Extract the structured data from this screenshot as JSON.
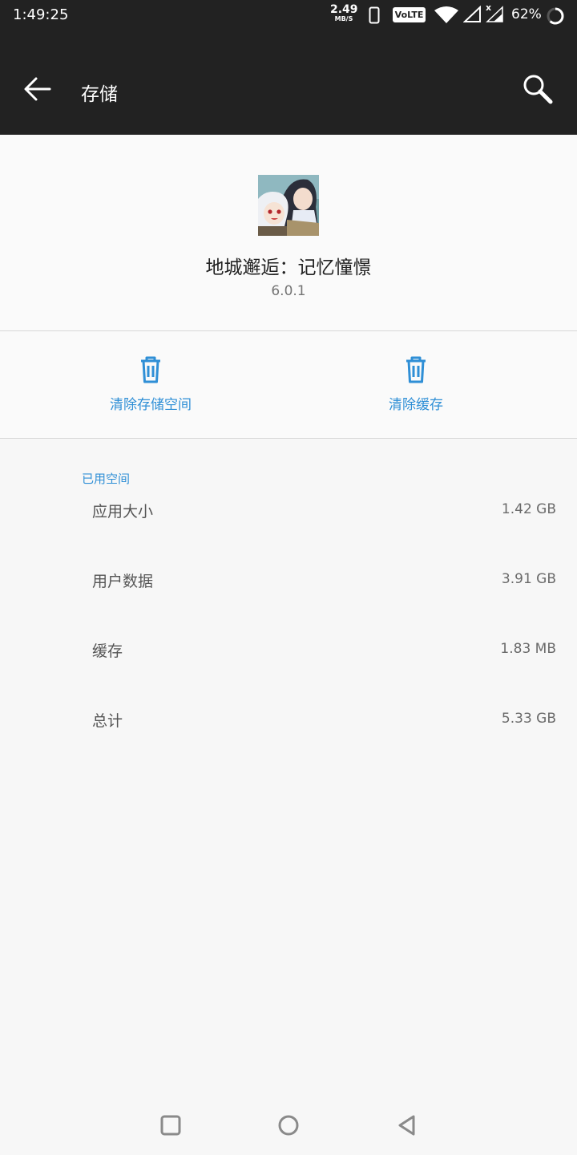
{
  "status_bar": {
    "time": "1:49:25",
    "net_speed_value": "2.49",
    "net_speed_unit": "MB/S",
    "volte_label": "VoLTE",
    "roaming_mark": "x",
    "battery_percent": "62%",
    "battery_level": 0.62
  },
  "app_bar": {
    "title": "存储",
    "back_icon": "arrow-left-icon",
    "search_icon": "search-icon"
  },
  "app": {
    "name": "地城邂逅：记忆憧憬",
    "version": "6.0.1"
  },
  "actions": {
    "clear_storage_label": "清除存储空间",
    "clear_cache_label": "清除缓存",
    "icon": "trash-icon"
  },
  "storage": {
    "section_title": "已用空间",
    "rows": [
      {
        "label": "应用大小",
        "value": "1.42 GB"
      },
      {
        "label": "用户数据",
        "value": "3.91 GB"
      },
      {
        "label": "缓存",
        "value": "1.83 MB"
      },
      {
        "label": "总计",
        "value": "5.33 GB"
      }
    ]
  },
  "colors": {
    "app_bar_bg": "#222222",
    "accent": "#2f8fd6",
    "page_bg": "#f7f7f7"
  }
}
